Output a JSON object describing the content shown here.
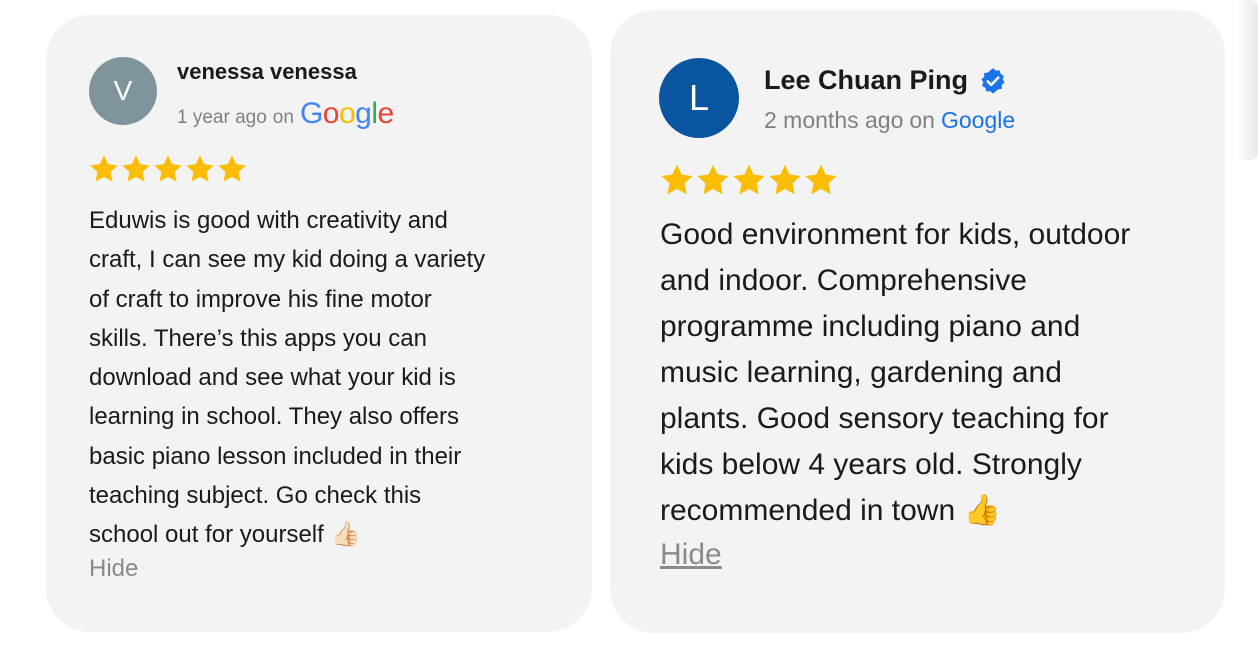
{
  "reviews": [
    {
      "avatar_letter": "V",
      "avatar_color": "#7f949c",
      "name": "venessa venessa",
      "verified": false,
      "time": "1 year ago",
      "on": "on",
      "source": "Google",
      "rating": 5,
      "text": "Eduwis is good with creativity and\ncraft, I can see my kid doing a variety\nof craft to improve his fine motor\nskills. There’s this apps you can\ndownload and see what your kid is\nlearning in school. They also offers\nbasic piano lesson included in their\nteaching subject. Go check this\nschool out for yourself 👍🏻",
      "hide_label": "Hide"
    },
    {
      "avatar_letter": "L",
      "avatar_color": "#0a559f",
      "name": "Lee Chuan Ping",
      "verified": true,
      "time": "2 months ago",
      "on": "on",
      "source": "Google",
      "rating": 5,
      "text": "Good environment for kids, outdoor\nand indoor. Comprehensive\nprogramme including piano and\nmusic learning, gardening and\nplants. Good sensory teaching for\nkids below 4 years old. Strongly\nrecommended in town 👍",
      "hide_label": "Hide"
    }
  ],
  "colors": {
    "card_bg": "#f3f3f3",
    "star": "#fbbc05",
    "verified_badge": "#1a73e8",
    "google_blue": "#4285f4",
    "google_red": "#ea4335",
    "google_yellow": "#fbbc05",
    "google_green": "#34a853"
  },
  "icons": {
    "star": "star-icon",
    "verified": "verified-badge-icon",
    "google": "google-logo"
  }
}
